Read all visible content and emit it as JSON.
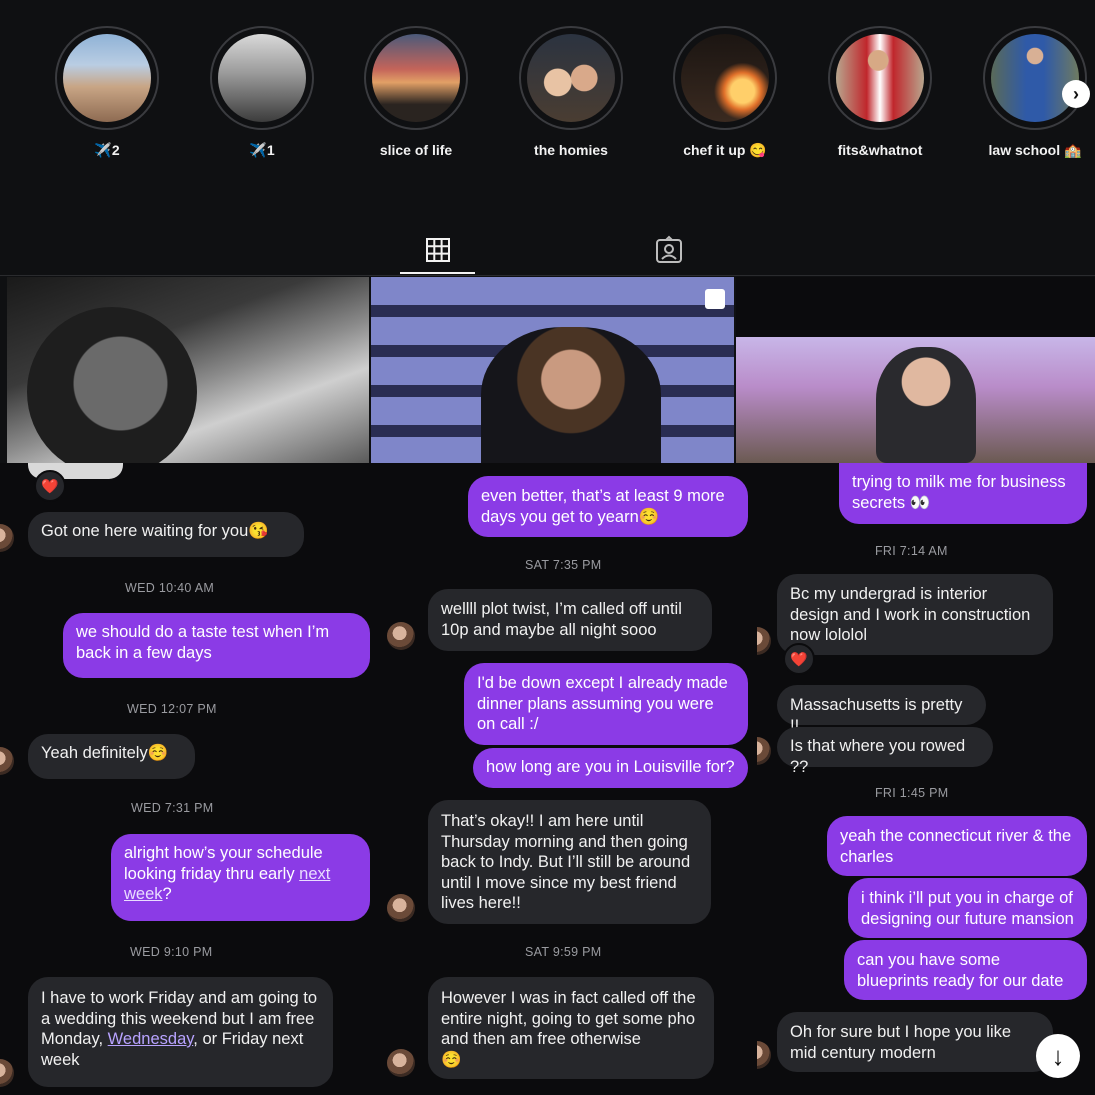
{
  "highlights": [
    {
      "label": "✈️2"
    },
    {
      "label": "✈️1"
    },
    {
      "label": "slice of life"
    },
    {
      "label": "the homies"
    },
    {
      "label": "chef it up 😋"
    },
    {
      "label": "fits&whatnot"
    },
    {
      "label": "law school 🏫"
    }
  ],
  "icons": {
    "next": "chevron-right-icon",
    "grid": "grid-icon",
    "tagged": "tagged-person-icon",
    "scroll": "arrow-down-icon",
    "carousel": "carousel-icon"
  },
  "colors": {
    "outgoing": "#8b3be6",
    "incoming": "#26272b",
    "background": "#0b0b0d"
  },
  "chat_left": {
    "msg1": "Got one here waiting for you😘",
    "ts1": "WED 10:40 AM",
    "msg2": "we should do a taste test when I’m back in a few days",
    "ts2": "WED 12:07 PM",
    "msg3": "Yeah definitely☺️",
    "ts3": "WED 7:31 PM",
    "msg4a": "alright how’s your schedule looking friday thru early ",
    "msg4_link": "next week",
    "msg4b": "?",
    "ts4": "WED 9:10 PM",
    "msg5a": "I have to work Friday and am going to a wedding this weekend but I am free Monday, ",
    "msg5_link": "Wednesday",
    "msg5b": ", or Friday next week",
    "reaction": "❤️"
  },
  "chat_middle": {
    "msg1": "even better, that’s at least 9 more days you get to yearn☺️",
    "ts1": "SAT 7:35 PM",
    "msg2": "wellll plot twist, I’m called off until 10p and maybe all night sooo",
    "msg3": "I'd be down except I already made dinner plans assuming you were on call :/",
    "msg4": "how long are you in Louisville for?",
    "msg5": "That’s okay!! I am here until Thursday morning and then going back to Indy. But I’ll still be around until I move since my best friend lives here!!",
    "ts2": "SAT 9:59 PM",
    "msg6": "However I was in fact called off the entire night, going to get some pho and then am free otherwise",
    "msg6_emoji": "☺️"
  },
  "chat_right": {
    "msg1": "trying to milk me for business secrets 👀",
    "ts1": "FRI 7:14 AM",
    "msg2": "Bc my undergrad is interior design and I work in construction now lololol",
    "reaction": "❤️",
    "msg3": "Massachusetts is pretty !!",
    "msg4": "Is that where you rowed ??",
    "ts2": "FRI 1:45 PM",
    "msg5": "yeah the connecticut river & the charles",
    "msg6": "i think i’ll put you in charge of designing our future mansion",
    "msg7": "can you have some blueprints ready for our date",
    "msg8": "Oh for sure but I hope you like mid century modern"
  }
}
